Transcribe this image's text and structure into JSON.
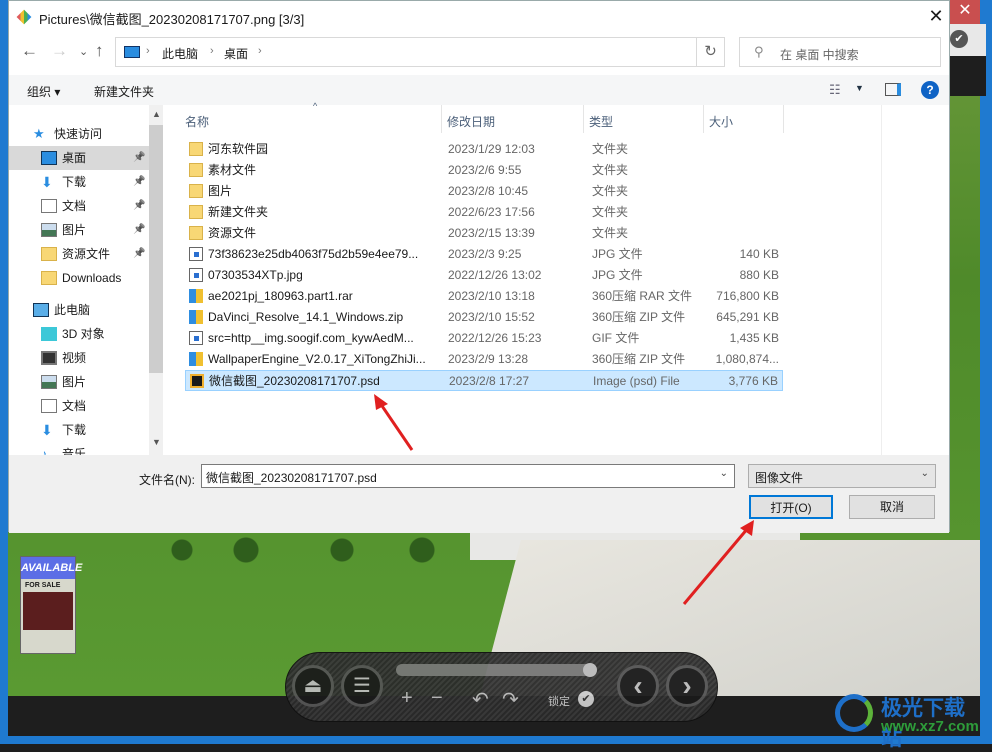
{
  "window": {
    "title": "Pictures\\微信截图_20230208171707.png [3/3]",
    "close": "✕"
  },
  "nav": {
    "back": "←",
    "forward": "→",
    "recent": "⌄",
    "up": "↑",
    "breadcrumb": [
      "此电脑",
      "桌面"
    ],
    "refresh": "↻",
    "search_placeholder": "在 桌面 中搜索"
  },
  "toolbar": {
    "organize": "组织 ▾",
    "new_folder": "新建文件夹"
  },
  "sidebar": {
    "items": [
      {
        "label": "快速访问",
        "icon": "star-icon",
        "header": true
      },
      {
        "label": "桌面",
        "icon": "desktop-icon",
        "pinned": true,
        "selected": true
      },
      {
        "label": "下载",
        "icon": "download-icon",
        "pinned": true
      },
      {
        "label": "文档",
        "icon": "document-icon",
        "pinned": true
      },
      {
        "label": "图片",
        "icon": "pictures-icon",
        "pinned": true
      },
      {
        "label": "资源文件",
        "icon": "folder-icon",
        "pinned": true
      },
      {
        "label": "Downloads",
        "icon": "folder-icon"
      },
      {
        "label": "此电脑",
        "icon": "computer-icon",
        "header": true
      },
      {
        "label": "3D 对象",
        "icon": "3d-objects-icon"
      },
      {
        "label": "视频",
        "icon": "video-icon"
      },
      {
        "label": "图片",
        "icon": "pictures-icon"
      },
      {
        "label": "文档",
        "icon": "document-icon"
      },
      {
        "label": "下载",
        "icon": "download-icon"
      },
      {
        "label": "音乐",
        "icon": "music-icon"
      }
    ]
  },
  "columns": {
    "name": "名称",
    "date": "修改日期",
    "type": "类型",
    "size": "大小"
  },
  "files": [
    {
      "name": "河东软件园",
      "date": "2023/1/29 12:03",
      "type": "文件夹",
      "size": "",
      "kind": "folder"
    },
    {
      "name": "素材文件",
      "date": "2023/2/6 9:55",
      "type": "文件夹",
      "size": "",
      "kind": "folder"
    },
    {
      "name": "图片",
      "date": "2023/2/8 10:45",
      "type": "文件夹",
      "size": "",
      "kind": "folder"
    },
    {
      "name": "新建文件夹",
      "date": "2022/6/23 17:56",
      "type": "文件夹",
      "size": "",
      "kind": "folder"
    },
    {
      "name": "资源文件",
      "date": "2023/2/15 13:39",
      "type": "文件夹",
      "size": "",
      "kind": "folder"
    },
    {
      "name": "73f38623e25db4063f75d2b59e4ee79...",
      "date": "2023/2/3 9:25",
      "type": "JPG 文件",
      "size": "140 KB",
      "kind": "file"
    },
    {
      "name": "07303534XTp.jpg",
      "date": "2022/12/26 13:02",
      "type": "JPG 文件",
      "size": "880 KB",
      "kind": "file"
    },
    {
      "name": "ae2021pj_180963.part1.rar",
      "date": "2023/2/10 13:18",
      "type": "360压缩 RAR 文件",
      "size": "716,800 KB",
      "kind": "arch"
    },
    {
      "name": "DaVinci_Resolve_14.1_Windows.zip",
      "date": "2023/2/10 15:52",
      "type": "360压缩 ZIP 文件",
      "size": "645,291 KB",
      "kind": "arch"
    },
    {
      "name": "src=http__img.soogif.com_kywAedM...",
      "date": "2022/12/26 15:23",
      "type": "GIF 文件",
      "size": "1,435 KB",
      "kind": "file"
    },
    {
      "name": "WallpaperEngine_V2.0.17_XiTongZhiJi...",
      "date": "2023/2/9 13:28",
      "type": "360压缩 ZIP 文件",
      "size": "1,080,874...",
      "kind": "arch"
    },
    {
      "name": "微信截图_20230208171707.psd",
      "date": "2023/2/8 17:27",
      "type": "Image (psd) File",
      "size": "3,776 KB",
      "kind": "psd",
      "selected": true
    }
  ],
  "bottom": {
    "filename_label": "文件名(N):",
    "filename_value": "微信截图_20230208171707.psd",
    "filter": "图像文件",
    "open": "打开(O)",
    "cancel": "取消",
    "dropdown": "⌄"
  },
  "viewer": {
    "eject": "⏏",
    "menu": "☰",
    "zoom_in": "+",
    "zoom_out": "−",
    "rotate_left": "↶",
    "rotate_right": "↷",
    "lock_label": "锁定",
    "lock_check": "✔",
    "prev": "‹",
    "next": "›",
    "progress": 0.97
  },
  "photo_sign": {
    "available": "AVAILABLE",
    "for_sale": "FOR SALE"
  },
  "watermark": {
    "name": "极光下载站",
    "url": "www.xz7.com"
  },
  "colors": {
    "accent": "#0078d7",
    "selection": "#cce8ff",
    "arrow": "#e02020"
  }
}
